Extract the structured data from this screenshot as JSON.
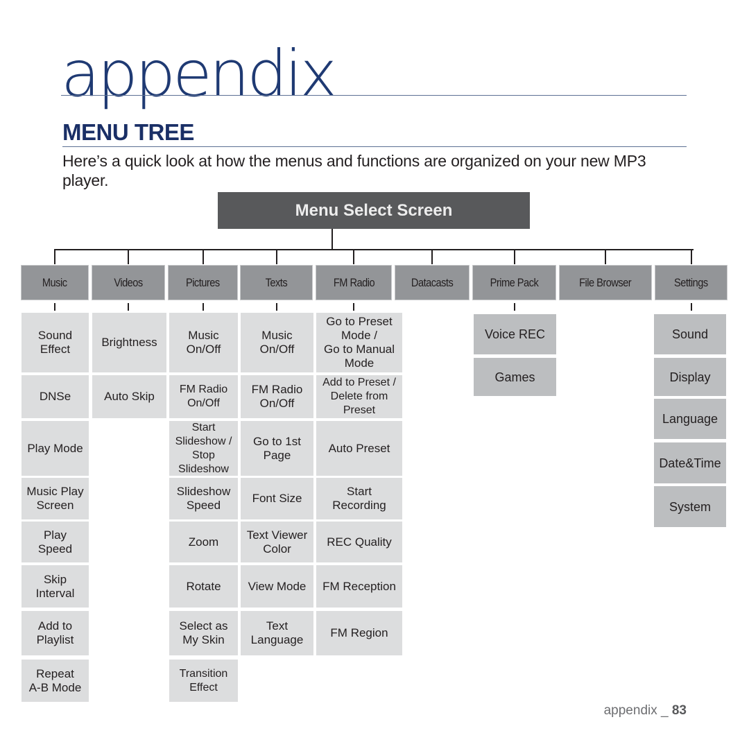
{
  "page": {
    "chapter_title": "appendix",
    "section_title": "MENU TREE",
    "intro": "Here’s a quick look at how the menus and functions are organized on your new MP3 player.",
    "footer_label": "appendix _",
    "page_number": "83"
  },
  "tree": {
    "root": "Menu Select Screen",
    "categories": [
      {
        "label": "Music",
        "items": [
          "Sound\nEffect",
          "DNSe",
          "Play Mode",
          "Music Play\nScreen",
          "Play\nSpeed",
          "Skip\nInterval",
          "Add to\nPlaylist",
          "Repeat\nA-B Mode"
        ]
      },
      {
        "label": "Videos",
        "items": [
          "Brightness",
          "Auto Skip"
        ]
      },
      {
        "label": "Pictures",
        "items": [
          "Music\nOn/Off",
          "FM Radio\nOn/Off",
          "Start\nSlideshow /\nStop\nSlideshow",
          "Slideshow\nSpeed",
          "Zoom",
          "Rotate",
          "Select as\nMy Skin",
          "Transition\nEffect"
        ]
      },
      {
        "label": "Texts",
        "items": [
          "Music\nOn/Off",
          "FM Radio\nOn/Off",
          "Go to 1st\nPage",
          "Font Size",
          "Text Viewer\nColor",
          "View Mode",
          "Text\nLanguage"
        ]
      },
      {
        "label": "FM Radio",
        "items": [
          "Go to Preset\nMode /\nGo to Manual\nMode",
          "Add to Preset /\nDelete from\nPreset",
          "Auto Preset",
          "Start\nRecording",
          "REC Quality",
          "FM Reception",
          "FM Region"
        ]
      },
      {
        "label": "Datacasts",
        "items": []
      },
      {
        "label": "Prime Pack",
        "items": [
          "Voice REC",
          "Games"
        ]
      },
      {
        "label": "File Browser",
        "items": []
      },
      {
        "label": "Settings",
        "items": [
          "Sound",
          "Display",
          "Language",
          "Date&Time",
          "System"
        ]
      }
    ]
  },
  "colors": {
    "title_blue": "#1f3a73",
    "root_box": "#58595b",
    "category_box": "#939598",
    "item_box": "#dcddde",
    "item_box_dark": "#bcbec0"
  }
}
